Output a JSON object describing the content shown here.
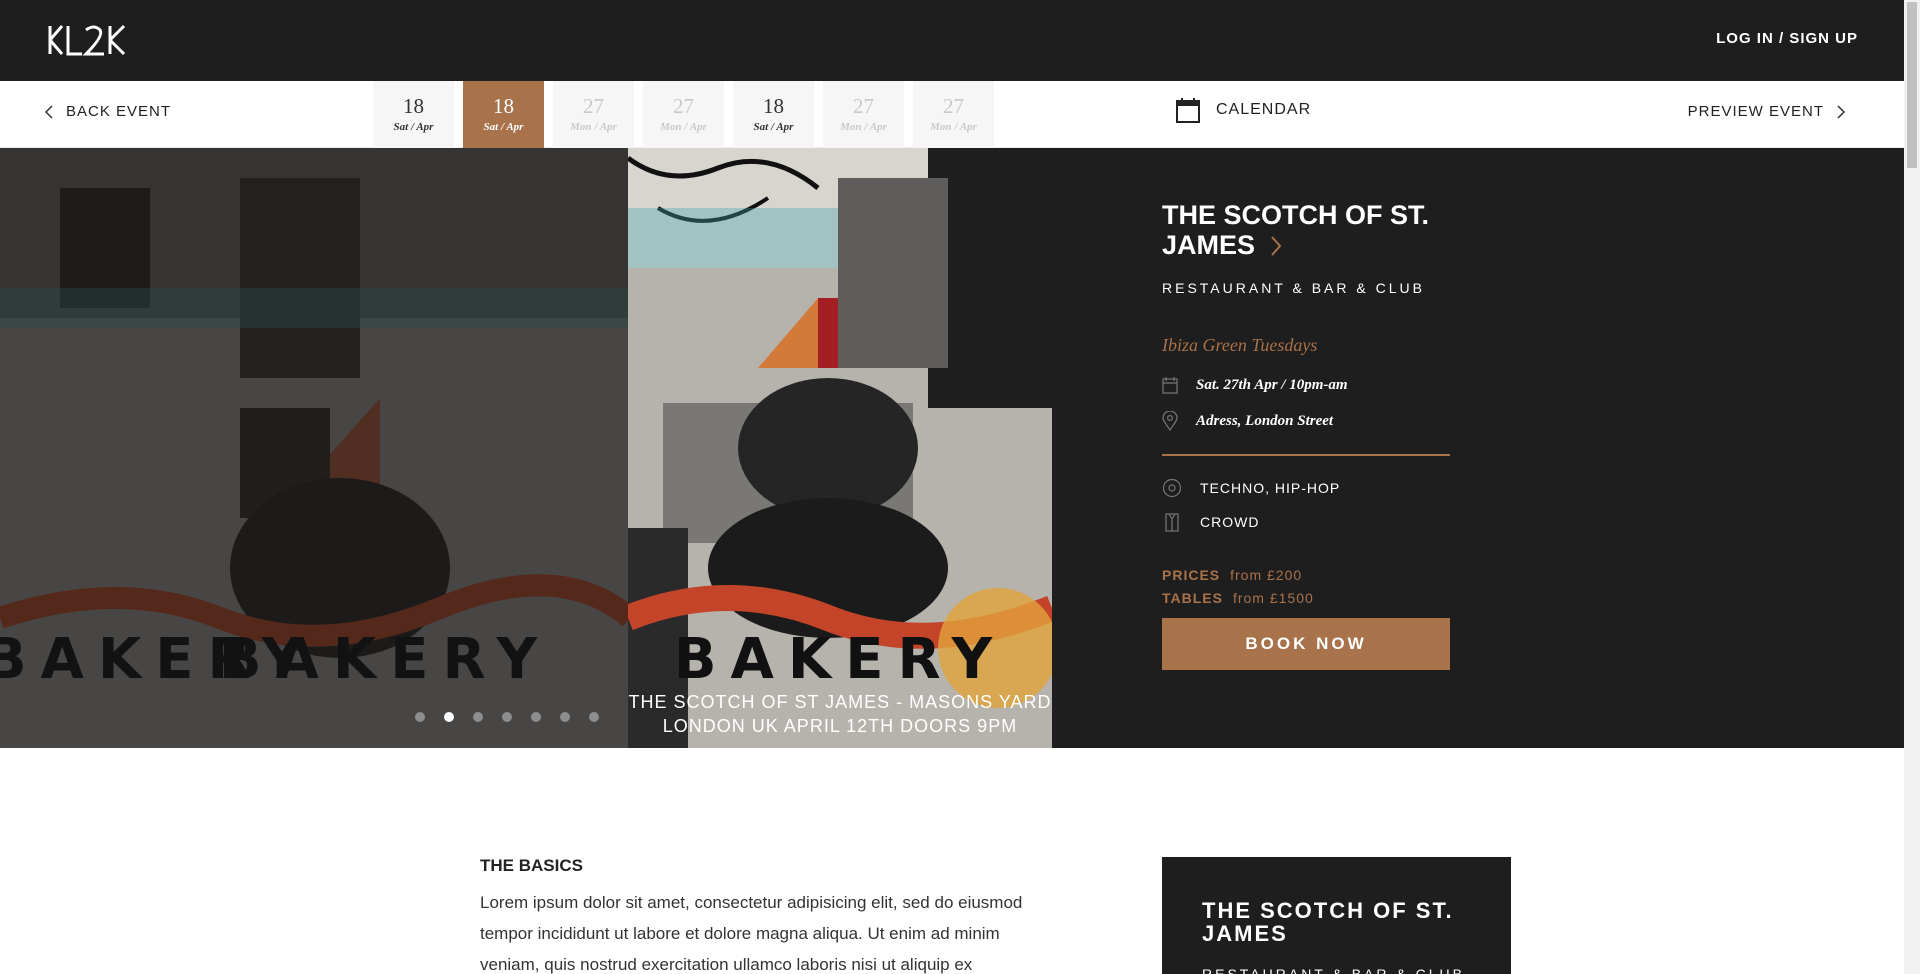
{
  "header": {
    "logo_text": "KL2K",
    "login_label": "LOG IN / SIGN UP"
  },
  "subnav": {
    "back_label": "BACK EVENT",
    "calendar_label": "CALENDAR",
    "preview_label": "PREVIEW EVENT",
    "dates": [
      {
        "day": "18",
        "month": "Sat / Apr",
        "state": "normal"
      },
      {
        "day": "18",
        "month": "Sat / Apr",
        "state": "active"
      },
      {
        "day": "27",
        "month": "Mon / Apr",
        "state": "faded"
      },
      {
        "day": "27",
        "month": "Mon / Apr",
        "state": "faded"
      },
      {
        "day": "18",
        "month": "Sat / Apr",
        "state": "normal"
      },
      {
        "day": "27",
        "month": "Mon / Apr",
        "state": "faded"
      },
      {
        "day": "27",
        "month": "Mon / Apr",
        "state": "faded"
      }
    ]
  },
  "hero": {
    "poster_title": "BAKERY",
    "poster_subtitle_1": "THE SCOTCH OF ST JAMES - MASONS YARD",
    "poster_subtitle_2": "LONDON UK APRIL 12TH DOORS 9PM",
    "slide_count": 7,
    "active_slide": 1
  },
  "event": {
    "venue": "THE SCOTCH OF ST. JAMES",
    "venue_type": "RESTAURANT & BAR & CLUB",
    "name": "Ibiza Green Tuesdays",
    "datetime": "Sat. 27th Apr / 10pm-am",
    "address": "Adress, London Street",
    "music": "TECHNO, HIP-HOP",
    "crowd": "CROWD",
    "prices_label": "PRICES",
    "prices_value": "from £200",
    "tables_label": "TABLES",
    "tables_value": "from £1500",
    "book_label": "BOOK NOW"
  },
  "basics": {
    "title": "THE BASICS",
    "text": "Lorem ipsum dolor sit amet, consectetur adipisicing elit, sed do eiusmod tempor incididunt ut labore et dolore magna aliqua. Ut enim ad minim veniam, quis nostrud exercitation ullamco laboris nisi ut aliquip ex"
  },
  "card": {
    "title": "THE SCOTCH OF ST. JAMES",
    "subtitle": "RESTAURANT & BAR & CLUB"
  },
  "colors": {
    "accent": "#a8724a",
    "dark": "#1f1e1e"
  }
}
